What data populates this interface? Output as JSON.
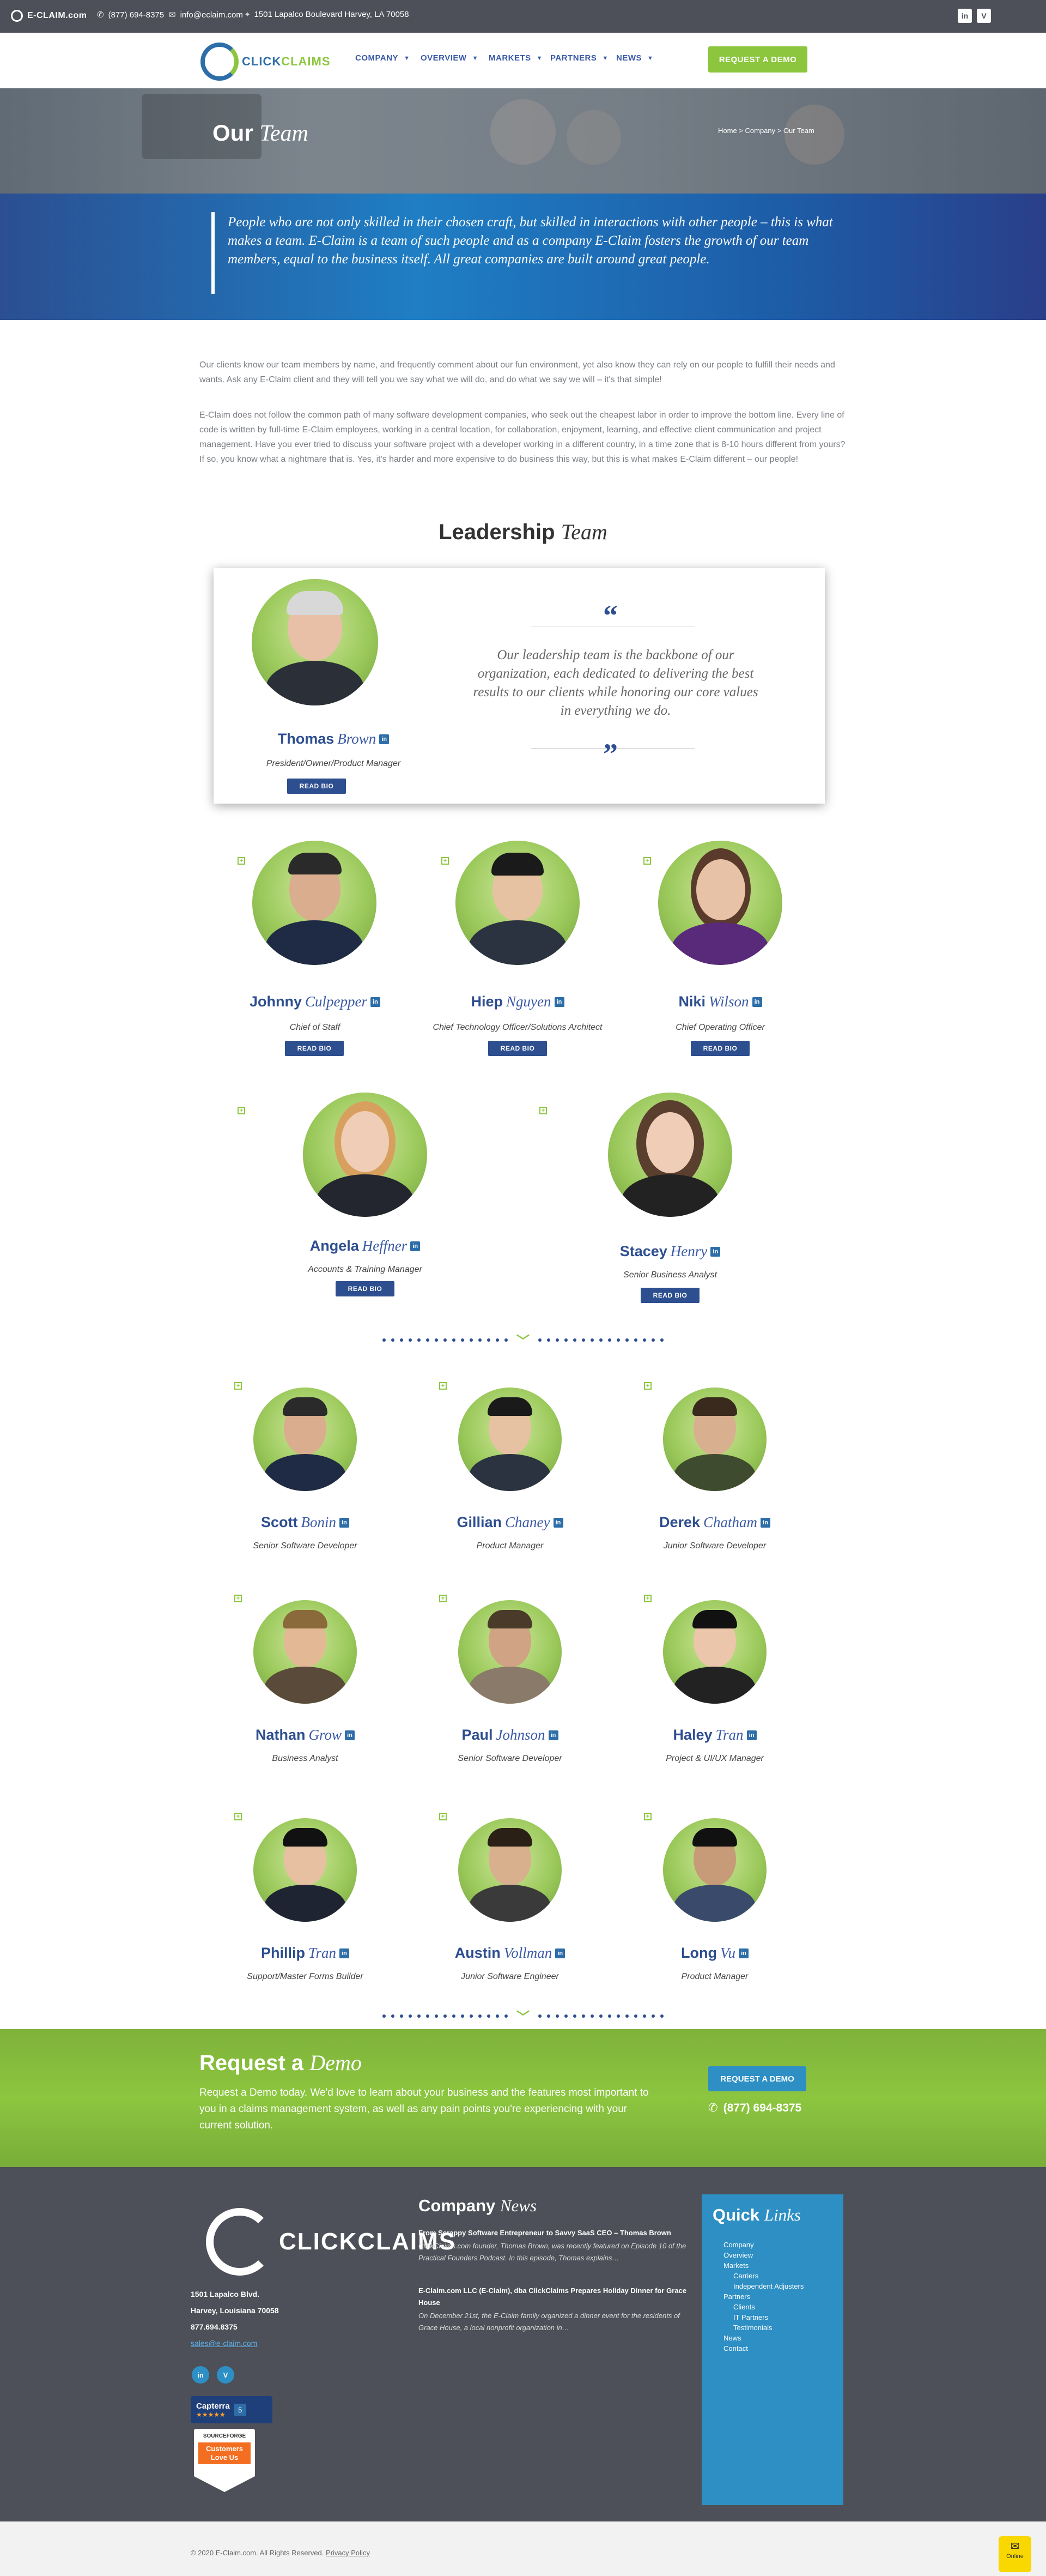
{
  "topbar": {
    "brand": "E-CLAIM.com",
    "phone": "(877) 694-8375",
    "email": "info@eclaim.com",
    "address": "1501 Lapalco Boulevard Harvey, LA 70058",
    "social": [
      "in",
      "V"
    ]
  },
  "header": {
    "logo_a": "CLICK",
    "logo_b": "CLAIMS",
    "nav": [
      "COMPANY",
      "OVERVIEW",
      "MARKETS",
      "PARTNERS",
      "NEWS"
    ],
    "cta": "REQUEST A DEMO"
  },
  "hero": {
    "title_a": "Our",
    "title_b": "Team",
    "breadcrumb": "Home  >  Company  >  Our Team"
  },
  "band_quote": "People who are not only skilled in their chosen craft, but skilled in interactions with other people – this is what makes a team. E-Claim is a team of such people and as a company E-Claim fosters the growth of our team members, equal to the business itself. All great companies are built around great people.",
  "intro": {
    "p1": "Our clients know our team members by name, and frequently comment about our fun environment, yet also know they can rely on our people to fulfill their needs and wants. Ask any E-Claim client and they will tell you we say what we will do, and do what we say we will – it's that simple!",
    "p2": "E-Claim does not follow the common path of many software development companies, who seek out the cheapest labor in order to improve the bottom line. Every line of code is written by full-time E-Claim employees, working in a central location, for collaboration, enjoyment, learning, and effective client communication and project management. Have you ever tried to discuss your software project with a developer working in a different country, in a time zone that is 8-10 hours different from yours? If so, you know what a nightmare that is. Yes, it's harder and more expensive to do business this way, but this is what makes E-Claim different – our people!"
  },
  "leadership": {
    "heading_a": "Leadership",
    "heading_b": "Team",
    "quote": "Our leadership team is the backbone of our organization, each dedicated to delivering the best results to our clients while honoring our core values in everything we do.",
    "read_bio": "READ BIO",
    "ceo": {
      "first": "Thomas",
      "last": "Brown",
      "title": "President/Owner/Product Manager"
    },
    "row1": [
      {
        "first": "Johnny",
        "last": "Culpepper",
        "title": "Chief of Staff"
      },
      {
        "first": "Hiep",
        "last": "Nguyen",
        "title": "Chief Technology Officer/Solutions Architect"
      },
      {
        "first": "Niki",
        "last": "Wilson",
        "title": "Chief Operating Officer"
      }
    ],
    "row2": [
      {
        "first": "Angela",
        "last": "Heffner",
        "title": "Accounts & Training Manager"
      },
      {
        "first": "Stacey",
        "last": "Henry",
        "title": "Senior Business Analyst"
      }
    ]
  },
  "staff": [
    {
      "first": "Scott",
      "last": "Bonin",
      "title": "Senior Software Developer"
    },
    {
      "first": "Gillian",
      "last": "Chaney",
      "title": "Product Manager"
    },
    {
      "first": "Derek",
      "last": "Chatham",
      "title": "Junior Software Developer"
    },
    {
      "first": "Nathan",
      "last": "Grow",
      "title": "Business Analyst"
    },
    {
      "first": "Paul",
      "last": "Johnson",
      "title": "Senior Software Developer"
    },
    {
      "first": "Haley",
      "last": "Tran",
      "title": "Project & UI/UX Manager"
    },
    {
      "first": "Phillip",
      "last": "Tran",
      "title": "Support/Master Forms Builder"
    },
    {
      "first": "Austin",
      "last": "Vollman",
      "title": "Junior Software Engineer"
    },
    {
      "first": "Long",
      "last": "Vu",
      "title": "Product Manager"
    }
  ],
  "request": {
    "title_a": "Request a",
    "title_b": "Demo",
    "text": "Request a Demo today. We'd love to learn about your business and the features most important to you in a claims management system, as well as any pain points you're experiencing with your current solution.",
    "cta": "REQUEST A DEMO",
    "phone": "(877) 694-8375"
  },
  "footer": {
    "logo": "CLICKCLAIMS",
    "addr1": "1501 Lapalco Blvd.",
    "addr2": "Harvey, Louisiana 70058",
    "phone": "877.694.8375",
    "email": "sales@e-claim.com",
    "capterra": "Capterra",
    "capterra_n": "5",
    "sf1": "SOURCEFORGE",
    "sf2": "Customers Love Us",
    "news_a": "Company",
    "news_b": "News",
    "news": [
      {
        "title": "From Scrappy Software Entrepreneur to Savvy SaaS CEO – Thomas Brown",
        "excerpt": "ClickClaims.com founder, Thomas Brown, was recently featured on Episode 10 of the Practical Founders Podcast. In this episode, Thomas explains…"
      },
      {
        "title": "E-Claim.com LLC (E-Claim), dba ClickClaims Prepares Holiday Dinner for Grace House",
        "excerpt": "On December 21st, the E-Claim family organized a dinner event for the residents of Grace House, a local nonprofit organization in…"
      }
    ],
    "ql_a": "Quick",
    "ql_b": "Links",
    "links": [
      "Company",
      "Overview",
      "Markets",
      "Carriers",
      "Independent Adjusters",
      "Partners",
      "Clients",
      "IT Partners",
      "Testimonials",
      "News",
      "Contact"
    ],
    "copyright": "© 2020 E-Claim.com. All Rights Reserved.",
    "privacy": "Privacy Policy",
    "chat": "Online"
  }
}
